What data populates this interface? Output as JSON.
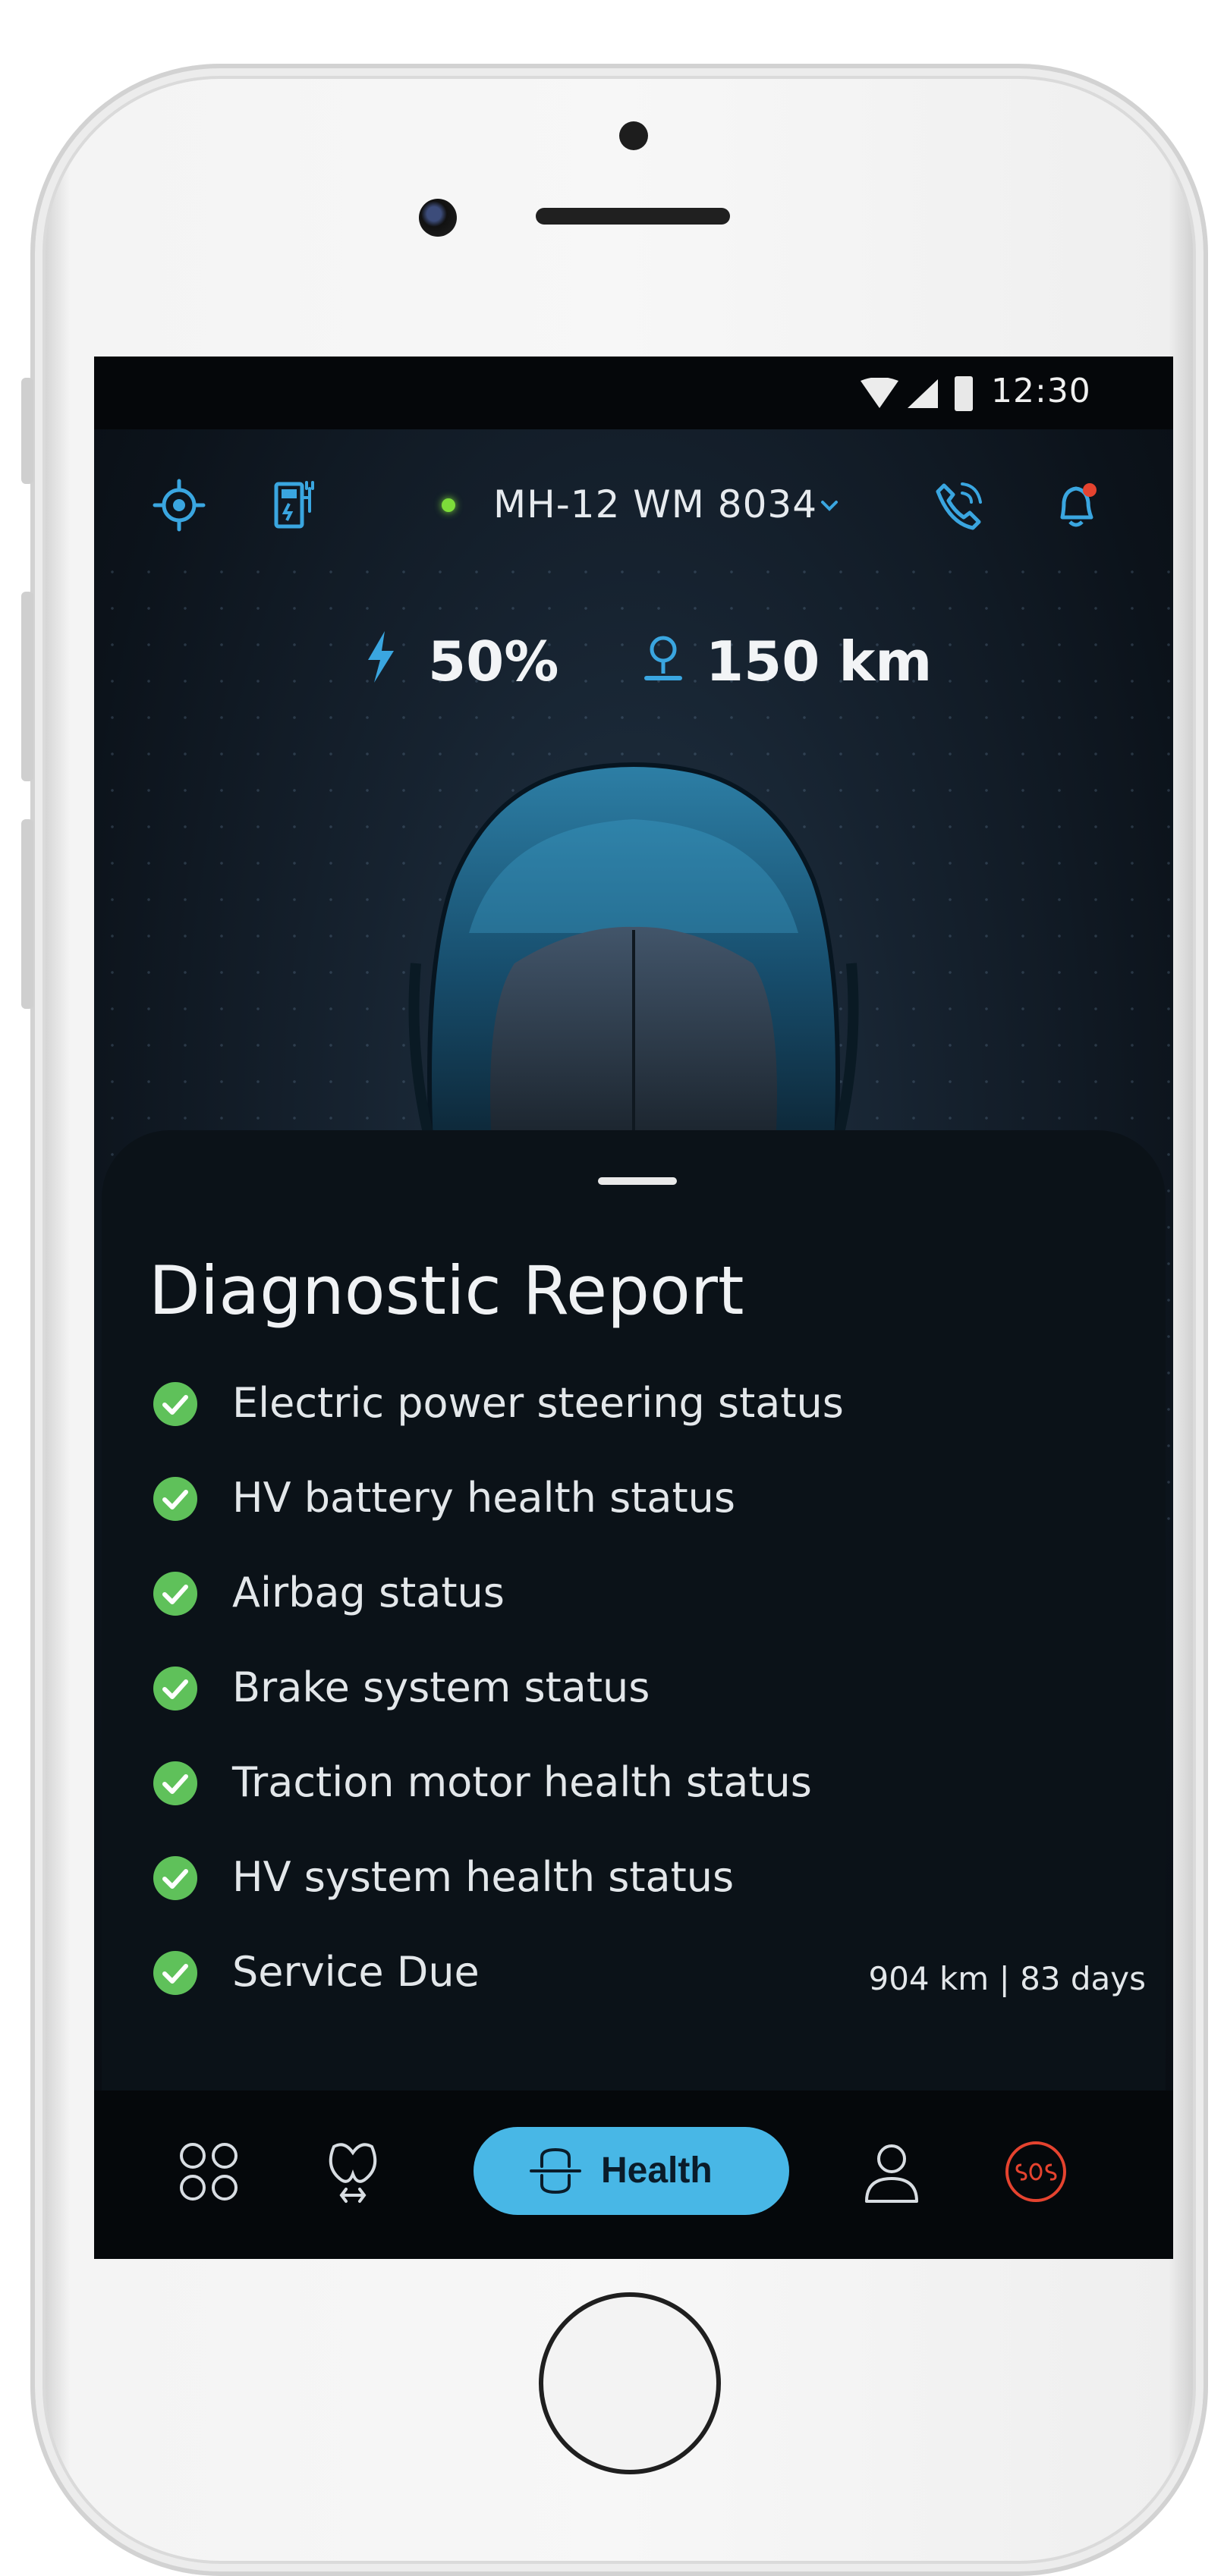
{
  "status_bar": {
    "time": "12:30",
    "icons": [
      "wifi-icon",
      "signal-icon",
      "battery-icon"
    ]
  },
  "header": {
    "left_icons": [
      "locate-icon",
      "charging-station-icon"
    ],
    "vehicle_plate": "MH-12 WM 8034",
    "vehicle_status_color": "#7ddc3a",
    "right_icons": [
      "call-support-icon",
      "notification-bell-icon"
    ]
  },
  "vehicle_stats": {
    "battery_percent": "50%",
    "range": "150 km"
  },
  "diagnostic_report": {
    "title": "Diagnostic Report",
    "items": [
      {
        "label": "Electric power steering status",
        "status": "ok"
      },
      {
        "label": "HV battery health status",
        "status": "ok"
      },
      {
        "label": "Airbag status",
        "status": "ok"
      },
      {
        "label": "Brake system status",
        "status": "ok"
      },
      {
        "label": "Traction motor health status",
        "status": "ok"
      },
      {
        "label": "HV system health status",
        "status": "ok"
      },
      {
        "label": "Service Due",
        "status": "ok",
        "meta": "904 km | 83 days"
      }
    ]
  },
  "bottom_nav": {
    "items": [
      {
        "icon": "dashboard-icon"
      },
      {
        "icon": "charging-icon"
      },
      {
        "icon": "health-icon",
        "label": "Health",
        "active": true
      },
      {
        "icon": "profile-icon"
      },
      {
        "icon": "sos-icon"
      }
    ]
  },
  "colors": {
    "accent": "#48b7e6",
    "ok": "#5fc15a",
    "sos": "#e5432f",
    "background": "#0b1218"
  }
}
